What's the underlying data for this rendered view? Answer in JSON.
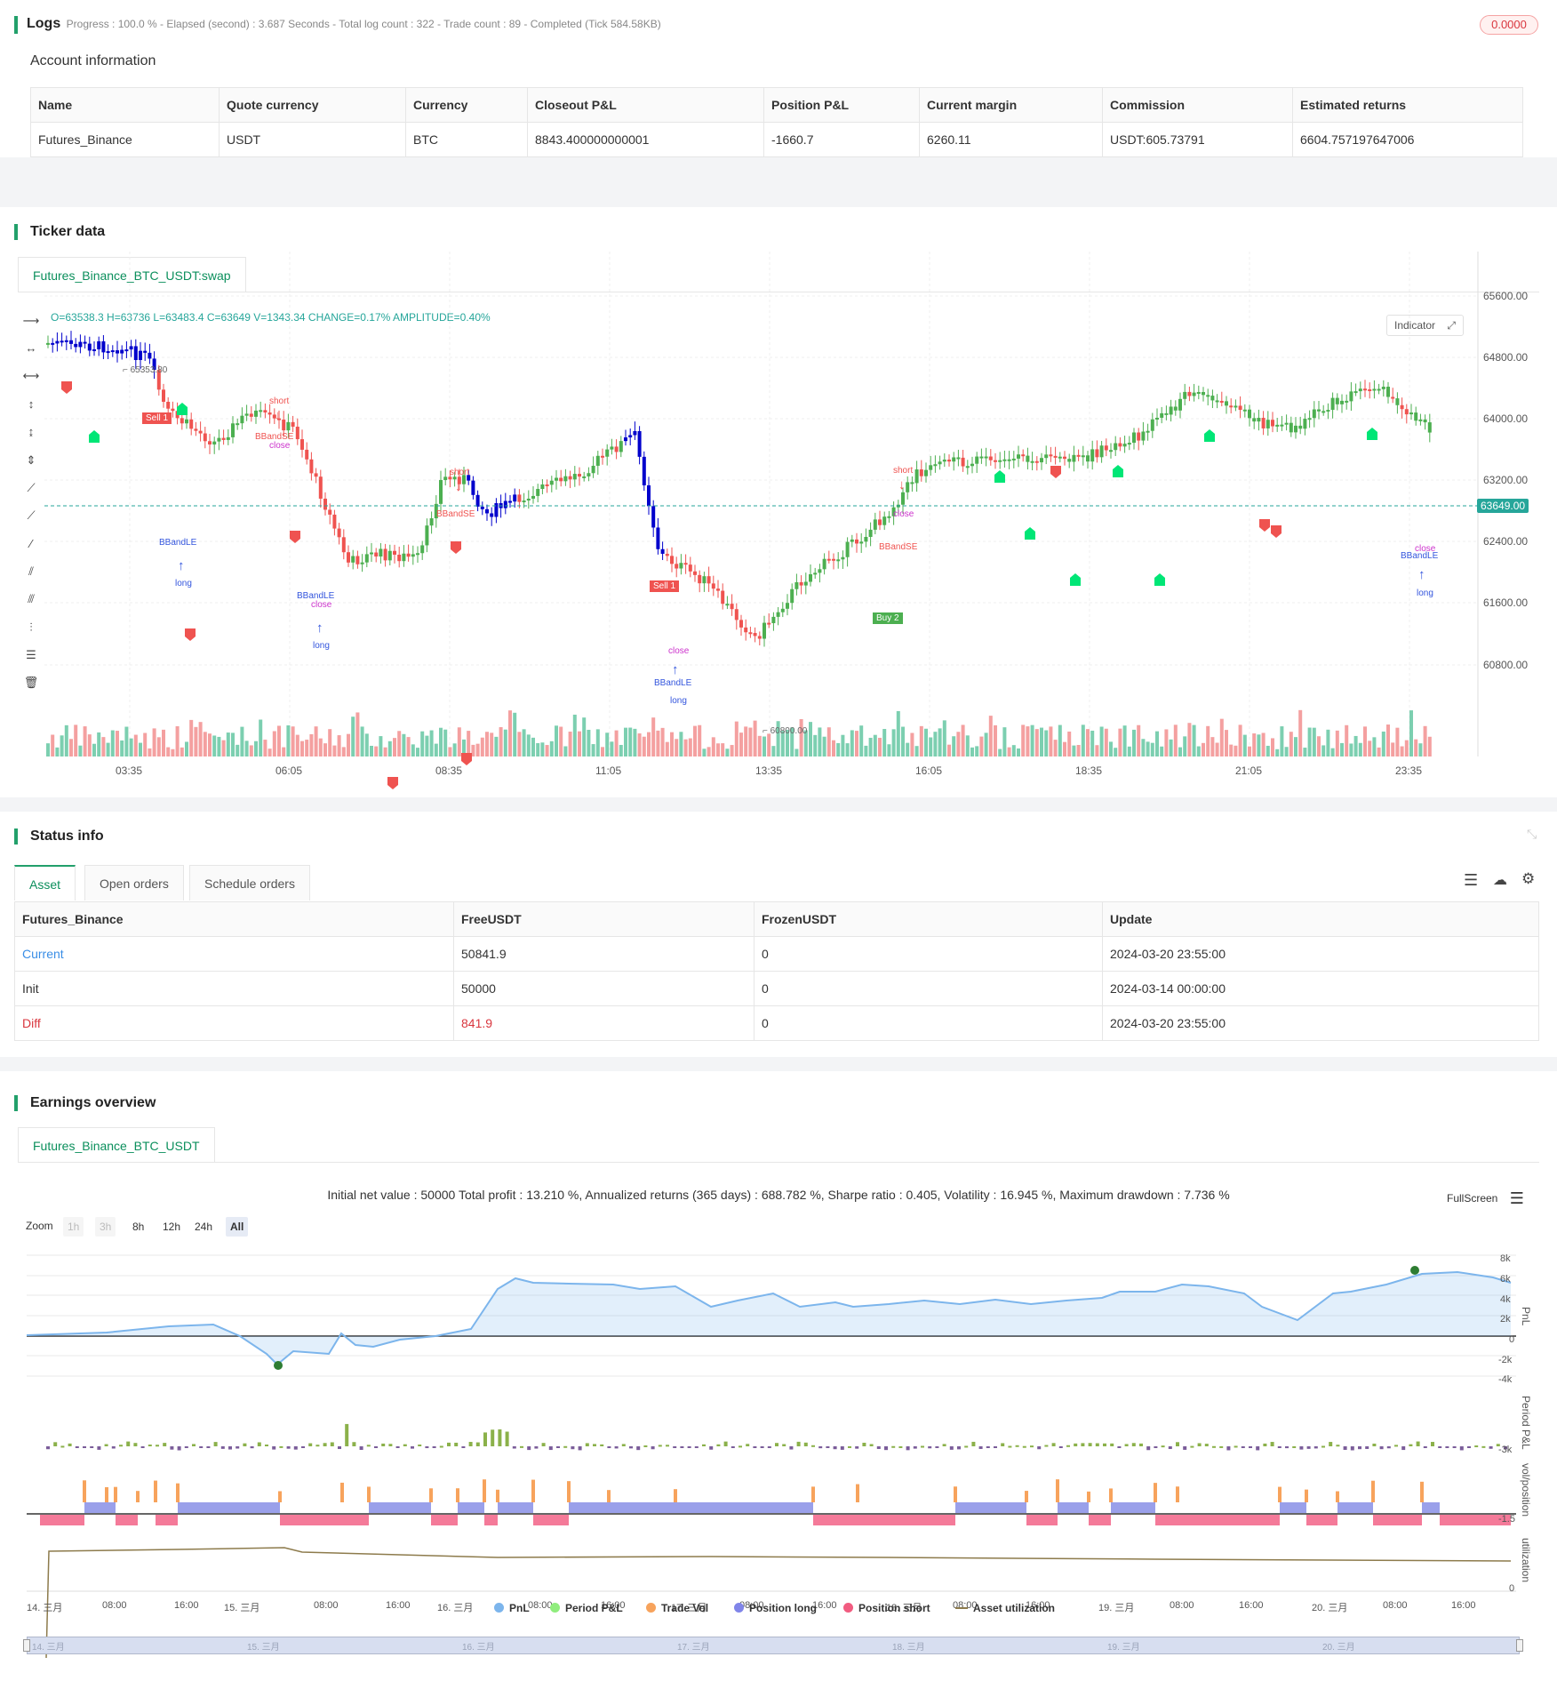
{
  "logs": {
    "title": "Logs",
    "status": "Progress : 100.0 % - Elapsed (second) : 3.687  Seconds - Total log count : 322 - Trade count : 89 - Completed (Tick 584.58KB)",
    "badge": "0.0000"
  },
  "account": {
    "title": "Account information",
    "headers": [
      "Name",
      "Quote currency",
      "Currency",
      "Closeout P&L",
      "Position P&L",
      "Current margin",
      "Commission",
      "Estimated returns"
    ],
    "row": [
      "Futures_Binance",
      "USDT",
      "BTC",
      "8843.400000000001",
      "-1660.7",
      "6260.11",
      "USDT:605.73791",
      "6604.757197647006"
    ]
  },
  "ticker": {
    "title": "Ticker data",
    "tab": "Futures_Binance_BTC_USDT:swap",
    "ohlc": "O=63538.3 H=63736 L=63483.4 C=63649 V=1343.34 CHANGE=0.17% AMPLITUDE=0.40%",
    "indicator_button": "Indicator",
    "price_ticks": [
      "65600.00",
      "64800.00",
      "64000.00",
      "63200.00",
      "62400.00",
      "61600.00",
      "60800.00"
    ],
    "current_price": "63649.00",
    "time_ticks": [
      "03:35",
      "06:05",
      "08:35",
      "11:05",
      "13:35",
      "16:05",
      "18:35",
      "21:05",
      "23:35"
    ],
    "high_label": "65353.80",
    "low_label": "60800.00",
    "annotations": {
      "short": "short",
      "long": "long",
      "close": "close",
      "bbandse": "BBandSE",
      "bbandle": "BBandLE",
      "sell1": "Sell 1",
      "buy2": "Buy 2",
      "one": "1"
    },
    "colors": {
      "up": "#4caf50",
      "down": "#ef5350",
      "blue": "#0000cc",
      "marker_green": "#00e676",
      "accent": "#26a69a"
    }
  },
  "status": {
    "title": "Status info",
    "tabs": [
      "Asset",
      "Open orders",
      "Schedule orders"
    ],
    "headers": [
      "Futures_Binance",
      "FreeUSDT",
      "FrozenUSDT",
      "Update"
    ],
    "rows": [
      [
        "Current",
        "50841.9",
        "0",
        "2024-03-20 23:55:00"
      ],
      [
        "Init",
        "50000",
        "0",
        "2024-03-14 00:00:00"
      ],
      [
        "Diff",
        "841.9",
        "0",
        "2024-03-20 23:55:00"
      ]
    ]
  },
  "earnings": {
    "title": "Earnings overview",
    "tab": "Futures_Binance_BTC_USDT",
    "summary": "Initial net value : 50000 Total profit : 13.210 %, Annualized returns (365 days) : 688.782 %, Sharpe ratio : 0.405, Volatility : 16.945 %, Maximum drawdown : 7.736 %",
    "fullscreen": "FullScreen",
    "zoom_label": "Zoom",
    "zoom_buttons": [
      "1h",
      "3h",
      "8h",
      "12h",
      "24h",
      "All"
    ],
    "pnl_ticks": [
      "8k",
      "6k",
      "4k",
      "2k",
      "0",
      "-2k",
      "-4k"
    ],
    "period_tick": "-3k",
    "pos_tick": "-1.5",
    "util_tick": "0",
    "axis_labels": [
      "PnL",
      "Period P&L",
      "vol/position",
      "utilization"
    ],
    "date_ticks": [
      "14. 三月",
      "08:00",
      "16:00",
      "15. 三月",
      "08:00",
      "16:00",
      "16. 三月",
      "08:00",
      "16:00",
      "17. 三月",
      "08:00",
      "16:00",
      "18. 三月",
      "08:00",
      "16:00",
      "19. 三月",
      "08:00",
      "16:00",
      "20. 三月",
      "08:00",
      "16:00"
    ],
    "legend": [
      {
        "name": "PnL",
        "color": "#7cb5ec"
      },
      {
        "name": "Period P&L",
        "color": "#90ed7d"
      },
      {
        "name": "Trade Vol",
        "color": "#f7a35c"
      },
      {
        "name": "Position long",
        "color": "#8085e9"
      },
      {
        "name": "Position short",
        "color": "#f15c80"
      },
      {
        "name": "Asset utilization",
        "color": "#8d7b4c"
      }
    ],
    "navigator_ticks": [
      "14. 三月",
      "15. 三月",
      "16. 三月",
      "17. 三月",
      "18. 三月",
      "19. 三月",
      "20. 三月"
    ]
  }
}
